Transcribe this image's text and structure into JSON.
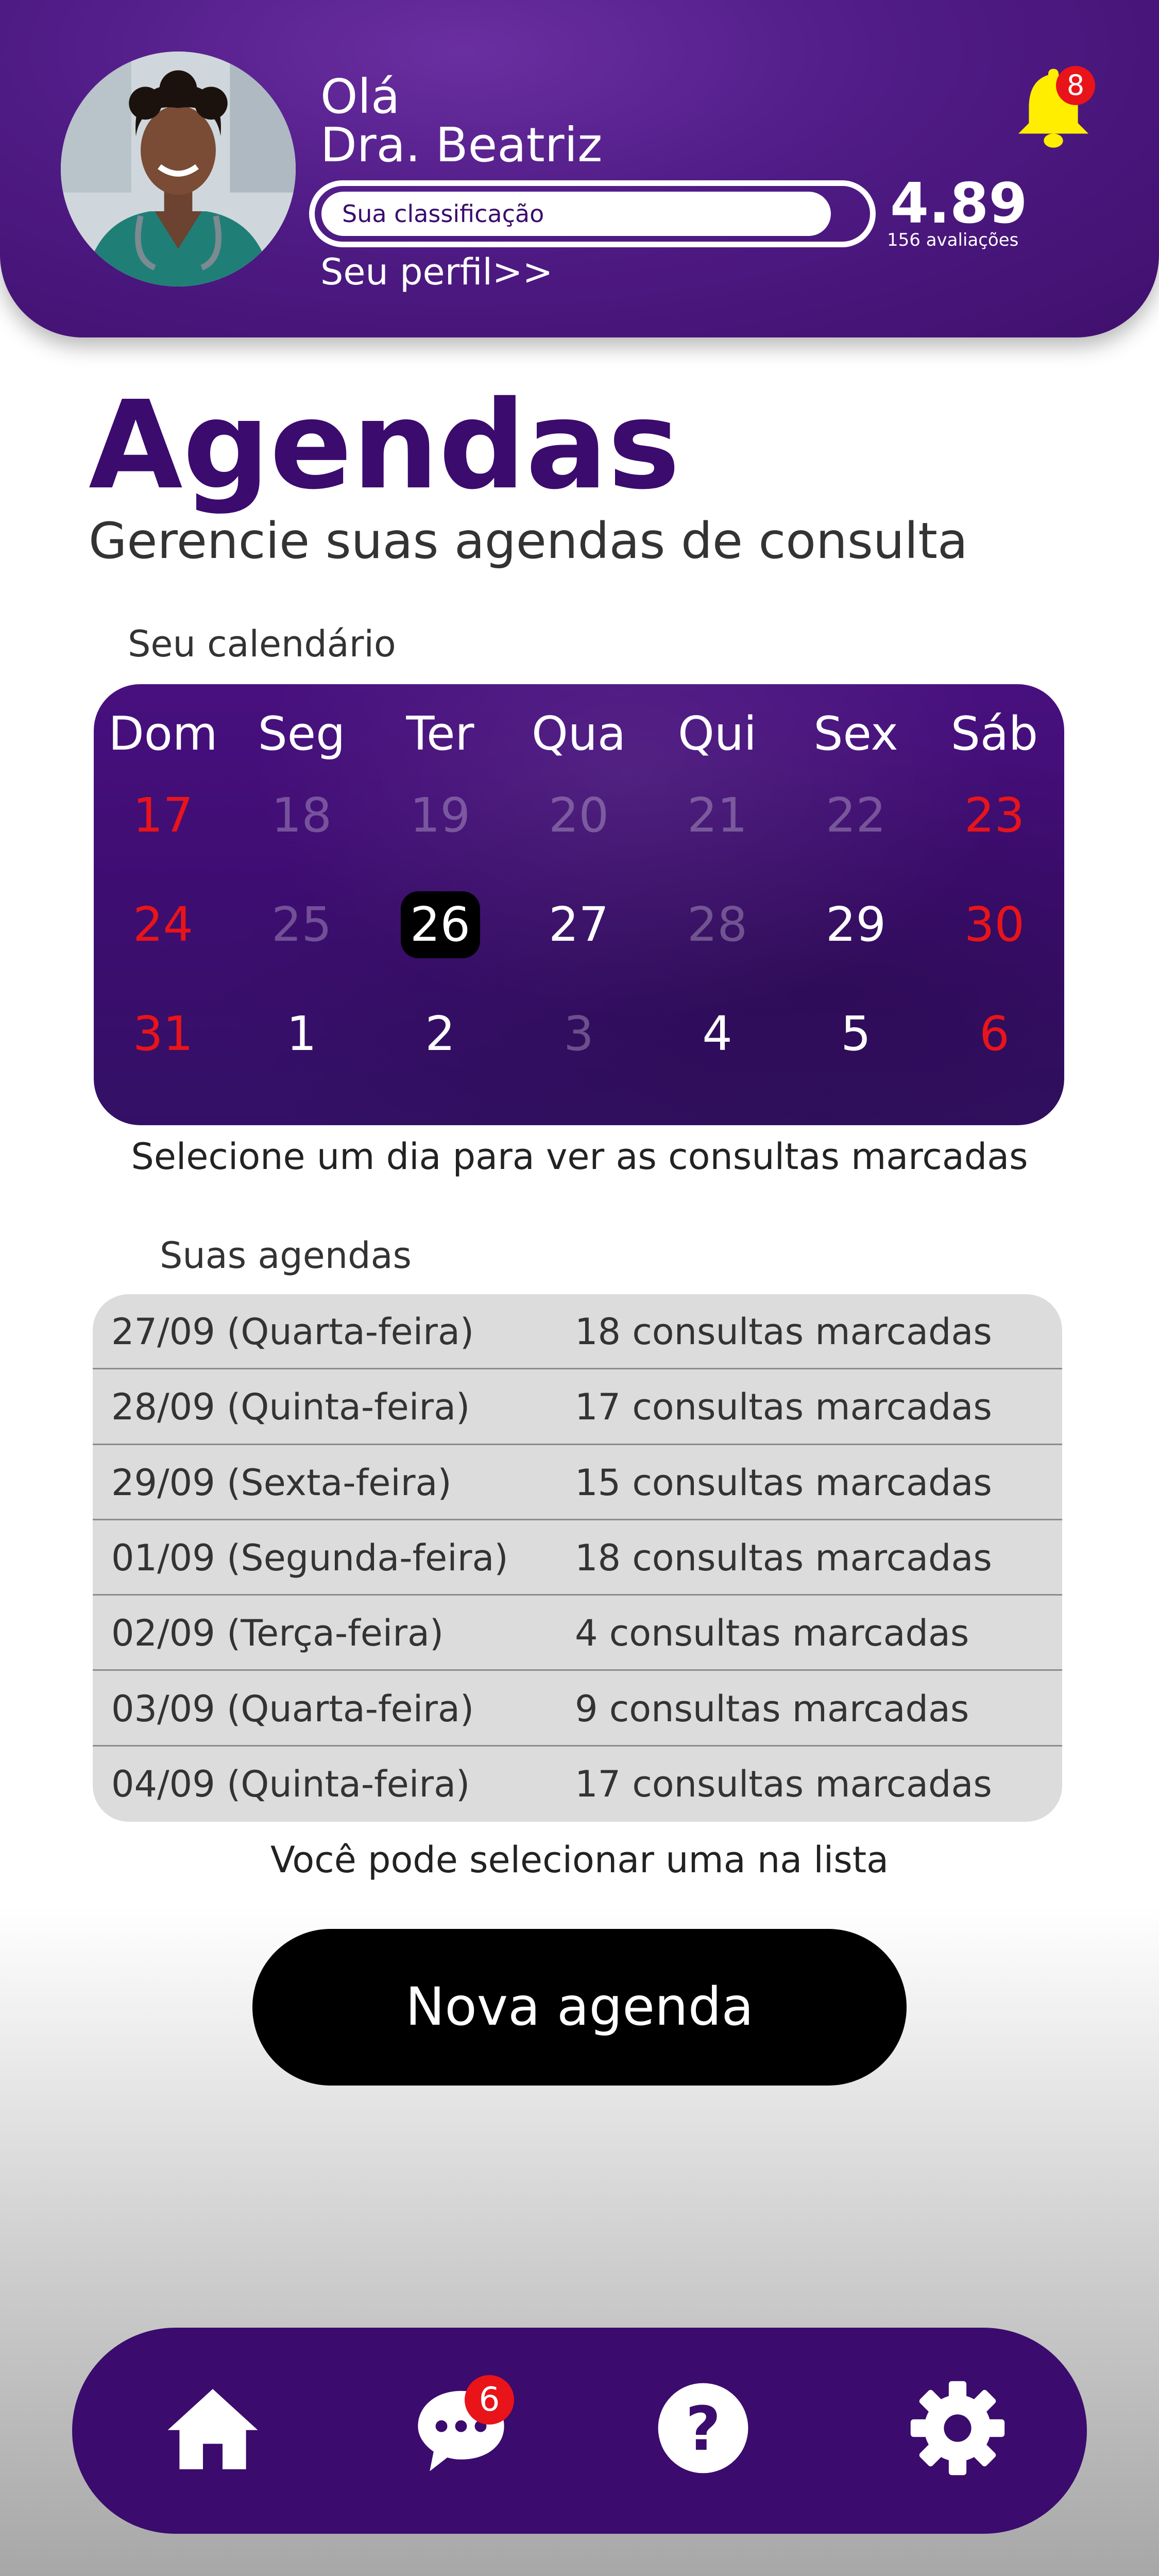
{
  "header": {
    "greeting": "Olá",
    "doctor_name": "Dra. Beatriz",
    "rating_label": "Sua classificação",
    "rating_value": "4.89",
    "rating_count": "156 avaliações",
    "rating_fill": 0.94,
    "profile_link": "Seu perfil>>",
    "notification_count": "8",
    "avatar_icon": "doctor-photo",
    "bell_icon": "bell-icon"
  },
  "page": {
    "title": "Agendas",
    "subtitle": "Gerencie suas agendas de consulta"
  },
  "calendar": {
    "caption": "Seu calendário",
    "weekdays": [
      "Dom",
      "Seg",
      "Ter",
      "Qua",
      "Qui",
      "Sex",
      "Sáb"
    ],
    "weeks": [
      [
        {
          "day": "17",
          "state": "red"
        },
        {
          "day": "18",
          "state": "dim"
        },
        {
          "day": "19",
          "state": "dim"
        },
        {
          "day": "20",
          "state": "dim"
        },
        {
          "day": "21",
          "state": "dim"
        },
        {
          "day": "22",
          "state": "dim"
        },
        {
          "day": "23",
          "state": "red"
        }
      ],
      [
        {
          "day": "24",
          "state": "red"
        },
        {
          "day": "25",
          "state": "dim"
        },
        {
          "day": "26",
          "state": "selected"
        },
        {
          "day": "27",
          "state": "active"
        },
        {
          "day": "28",
          "state": "dim"
        },
        {
          "day": "29",
          "state": "active"
        },
        {
          "day": "30",
          "state": "red"
        }
      ],
      [
        {
          "day": "31",
          "state": "red"
        },
        {
          "day": "1",
          "state": "active"
        },
        {
          "day": "2",
          "state": "active"
        },
        {
          "day": "3",
          "state": "dim"
        },
        {
          "day": "4",
          "state": "active"
        },
        {
          "day": "5",
          "state": "active"
        },
        {
          "day": "6",
          "state": "red"
        }
      ]
    ],
    "hint": "Selecione um dia para ver as consultas marcadas"
  },
  "schedules": {
    "caption": "Suas agendas",
    "rows": [
      {
        "date": "27/09 (Quarta-feira)",
        "count": "18 consultas marcadas"
      },
      {
        "date": "28/09 (Quinta-feira)",
        "count": "17 consultas marcadas"
      },
      {
        "date": "29/09 (Sexta-feira)",
        "count": "15 consultas marcadas"
      },
      {
        "date": "01/09 (Segunda-feira)",
        "count": "18 consultas marcadas"
      },
      {
        "date": "02/09 (Terça-feira)",
        "count": "4 consultas marcadas"
      },
      {
        "date": "03/09 (Quarta-feira)",
        "count": "9 consultas marcadas"
      },
      {
        "date": "04/09 (Quinta-feira)",
        "count": "17 consultas marcadas"
      }
    ],
    "hint": "Você pode selecionar uma na lista"
  },
  "actions": {
    "new_schedule": "Nova agenda"
  },
  "nav": {
    "items": [
      "home-icon",
      "chat-icon",
      "help-icon",
      "gear-icon"
    ],
    "chat_badge": "6"
  },
  "colors": {
    "primary": "#3b0b6e",
    "accent_red": "#e8141a",
    "bell": "#ffee00",
    "list_bg": "#dcdcdc"
  }
}
